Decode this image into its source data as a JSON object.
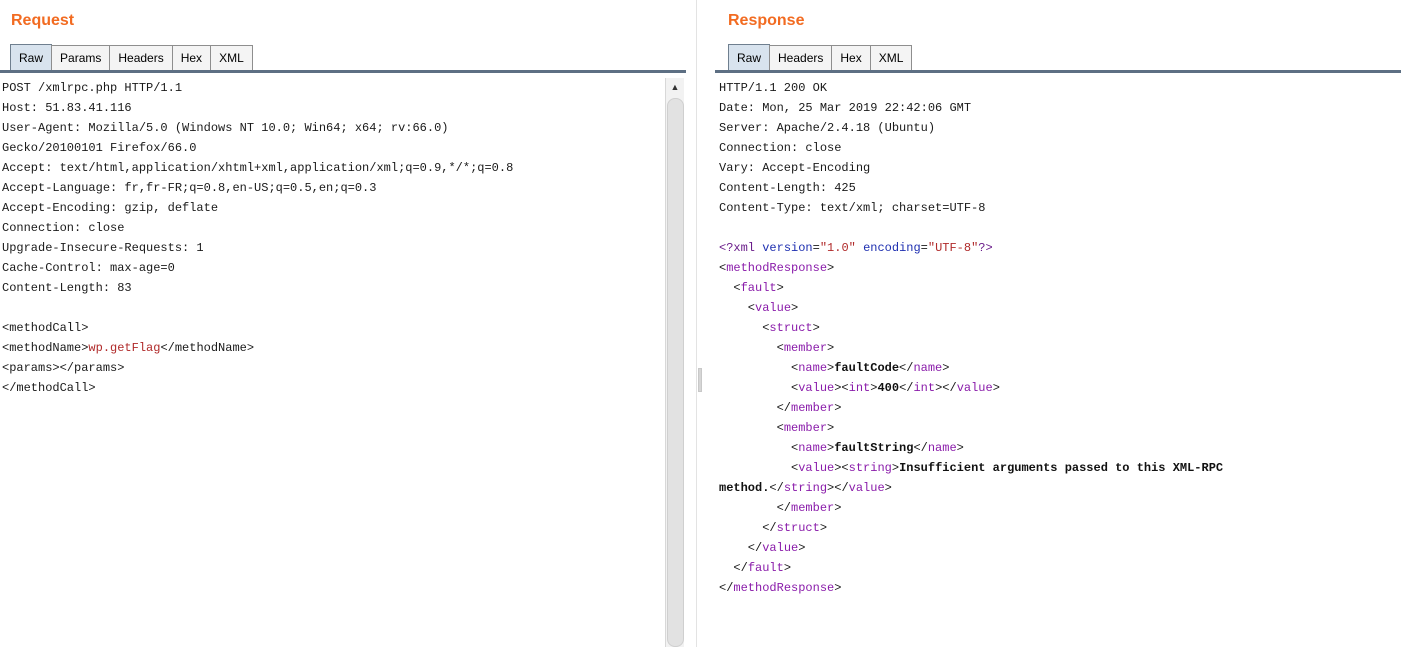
{
  "request": {
    "title": "Request",
    "tabs": [
      "Raw",
      "Params",
      "Headers",
      "Hex",
      "XML"
    ],
    "active_tab": "Raw",
    "headers": [
      "POST /xmlrpc.php HTTP/1.1",
      "Host: 51.83.41.116",
      "User-Agent: Mozilla/5.0 (Windows NT 10.0; Win64; x64; rv:66.0)",
      "Gecko/20100101 Firefox/66.0",
      "Accept: text/html,application/xhtml+xml,application/xml;q=0.9,*/*;q=0.8",
      "Accept-Language: fr,fr-FR;q=0.8,en-US;q=0.5,en;q=0.3",
      "Accept-Encoding: gzip, deflate",
      "Connection: close",
      "Upgrade-Insecure-Requests: 1",
      "Cache-Control: max-age=0",
      "Content-Length: 83"
    ],
    "body": {
      "method_call_open": "<methodCall>",
      "method_name_open": "<methodName>",
      "method_name_value": "wp.getFlag",
      "method_name_close": "</methodName>",
      "params": "<params></params>",
      "method_call_close": "</methodCall>"
    }
  },
  "response": {
    "title": "Response",
    "tabs": [
      "Raw",
      "Headers",
      "Hex",
      "XML"
    ],
    "active_tab": "Raw",
    "headers": [
      "HTTP/1.1 200 OK",
      "Date: Mon, 25 Mar 2019 22:42:06 GMT",
      "Server: Apache/2.4.18 (Ubuntu)",
      "Connection: close",
      "Vary: Accept-Encoding",
      "Content-Length: 425",
      "Content-Type: text/xml; charset=UTF-8"
    ],
    "xml": {
      "decl_open": "<?xml ",
      "attr_version": "version",
      "val_version": "\"1.0\"",
      "attr_encoding": "encoding",
      "val_encoding": "\"UTF-8\"",
      "decl_close": "?>",
      "method_response": "methodResponse",
      "fault": "fault",
      "value": "value",
      "struct": "struct",
      "member": "member",
      "name": "name",
      "int": "int",
      "string": "string",
      "fault_code_name": "faultCode",
      "fault_code_value": "400",
      "fault_string_name": "faultString",
      "fault_string_value_line1": "Insufficient arguments passed to this XML-RPC",
      "fault_string_value_line2": "method."
    }
  }
}
